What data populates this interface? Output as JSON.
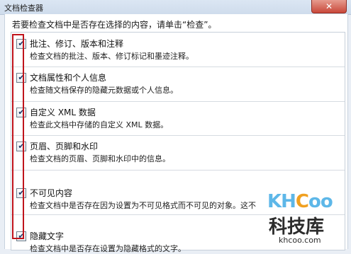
{
  "window": {
    "title": "文档检查器",
    "close_glyph": "✕"
  },
  "instruction": "若要检查文档中是否存在选择的内容，请单击“检查”。",
  "items": [
    {
      "title": "批注、修订、版本和注释",
      "desc": "检查文档的批注、版本、修订标记和墨迹注释。",
      "checked": true
    },
    {
      "title": "文档属性和个人信息",
      "desc": "检查随文档保存的隐藏元数据或个人信息。",
      "checked": true
    },
    {
      "title": "自定义 XML 数据",
      "desc": "检查此文档中存储的自定义 XML 数据。",
      "checked": true
    },
    {
      "title": "页眉、页脚和水印",
      "desc": "检查文档的页眉、页脚和水印中的信息。",
      "checked": true
    },
    {
      "title": "不可见内容",
      "desc": "检查文档中是否存在因为设置为不可见格式而不可见的对象。这不",
      "checked": true
    },
    {
      "title": "隐藏文字",
      "desc": "检查文档中是否存在设置为隐藏格式的文字。",
      "checked": true
    }
  ],
  "checkmark_glyph": "✔",
  "watermark": {
    "logo_prefix": "KH",
    "logo_c": "C",
    "logo_suffix": "oo",
    "cn": "科技库",
    "url": "khcoo.com"
  }
}
